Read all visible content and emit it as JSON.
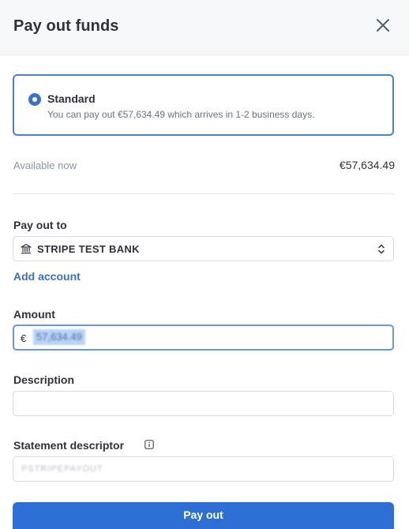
{
  "header": {
    "title": "Pay out funds",
    "close_icon": "close-icon"
  },
  "option": {
    "title": "Standard",
    "description": "You can pay out €57,634.49 which arrives in 1-2 business days.",
    "accent": "#3c6fd0"
  },
  "available": {
    "label": "Available now",
    "value": "€57,634.49"
  },
  "payout_to": {
    "label": "Pay out to",
    "bank_icon": "bank-icon",
    "bank_name": "STRIPE TEST BANK"
  },
  "add_account": "Add account",
  "amount": {
    "label": "Amount",
    "currency": "€",
    "value": "57,634.49"
  },
  "description": {
    "label": "Description",
    "value": ""
  },
  "statement": {
    "label": "Statement descriptor",
    "value": "PSTRIPEPAYOUT"
  },
  "button": {
    "label": "Pay out",
    "color": "#2d6fd4"
  }
}
